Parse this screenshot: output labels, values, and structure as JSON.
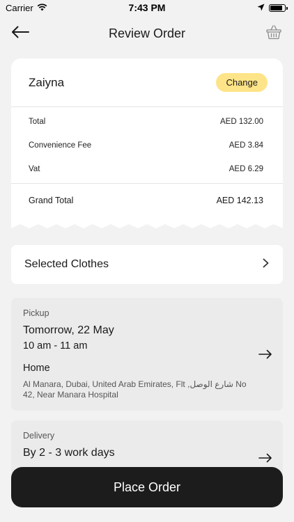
{
  "status_bar": {
    "carrier": "Carrier",
    "time": "7:43 PM",
    "battery_level": 0.85
  },
  "header": {
    "title": "Review Order",
    "back_icon": "arrow-left-icon",
    "basket_icon": "basket-icon"
  },
  "summary": {
    "customer_name": "Zaiyna",
    "change_label": "Change",
    "fees": [
      {
        "label": "Total",
        "value": "AED 132.00"
      },
      {
        "label": "Convenience Fee",
        "value": "AED 3.84"
      },
      {
        "label": "Vat",
        "value": "AED 6.29"
      }
    ],
    "grand_total_label": "Grand Total",
    "grand_total_value": "AED 142.13"
  },
  "clothes": {
    "label": "Selected Clothes"
  },
  "pickup": {
    "label": "Pickup",
    "date": "Tomorrow, 22 May",
    "time_slot": "10 am - 11 am",
    "place": "Home",
    "address": "Al Manara, Dubai, United Arab Emirates, Flt ,شارع الوصل No 42, Near Manara Hospital"
  },
  "delivery": {
    "label": "Delivery",
    "eta": "By 2 - 3 work days"
  },
  "actions": {
    "place_order_label": "Place Order"
  },
  "colors": {
    "accent_yellow": "#fde488",
    "button_dark": "#1c1c1c",
    "background": "#f2f2f2"
  }
}
